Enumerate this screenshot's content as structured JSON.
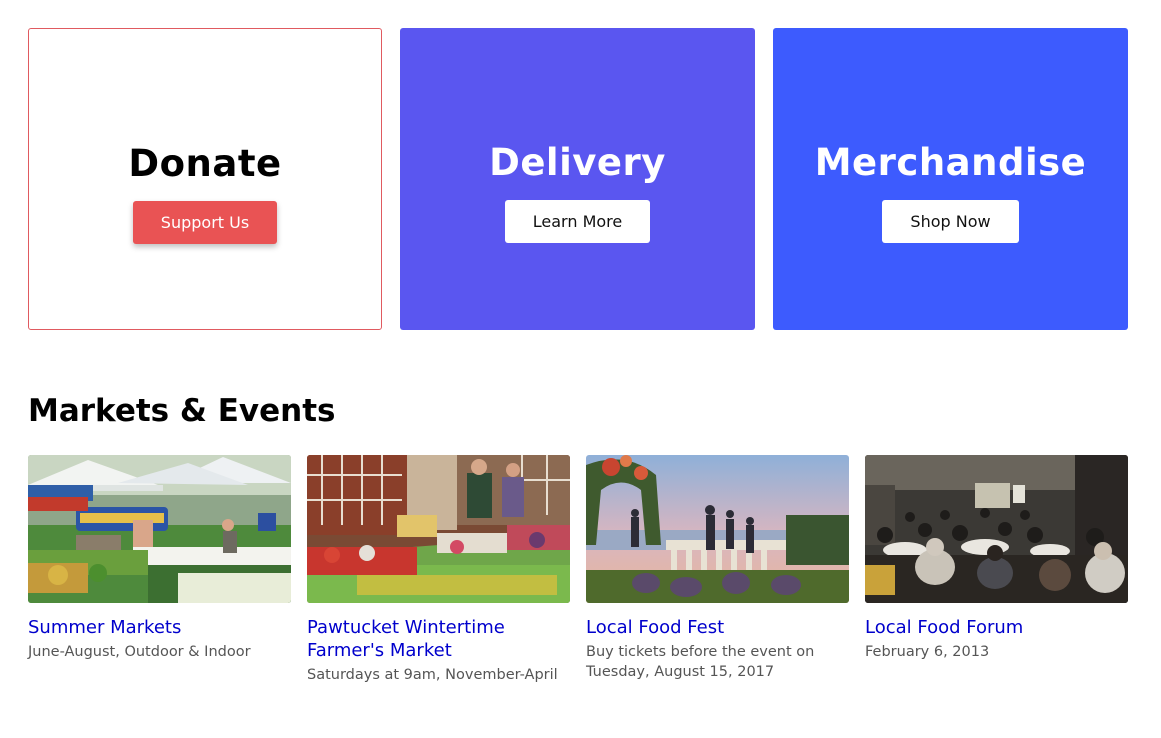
{
  "cta_cards": [
    {
      "title": "Donate",
      "button": "Support Us",
      "accent": "#e95354",
      "border": "#e05a60"
    },
    {
      "title": "Delivery",
      "button": "Learn More",
      "background": "#5a56f0"
    },
    {
      "title": "Merchandise",
      "button": "Shop Now",
      "background": "#3d5bfe"
    }
  ],
  "section": {
    "title": "Markets & Events"
  },
  "events": [
    {
      "title": "Summer Markets",
      "description": "June-August, Outdoor & Indoor",
      "image": "market-tents-photo"
    },
    {
      "title": "Pawtucket Wintertime Farmer's Market",
      "description": "Saturdays at 9am, November-April",
      "image": "produce-stand-photo"
    },
    {
      "title": "Local Food Fest",
      "description": "Buy tickets before the event on Tuesday, August 15, 2017",
      "image": "sunset-garden-party-photo"
    },
    {
      "title": "Local Food Forum",
      "description": "February 6, 2013",
      "image": "conference-audience-photo"
    }
  ],
  "colors": {
    "link": "#0000cc",
    "muted_text": "#555555"
  }
}
